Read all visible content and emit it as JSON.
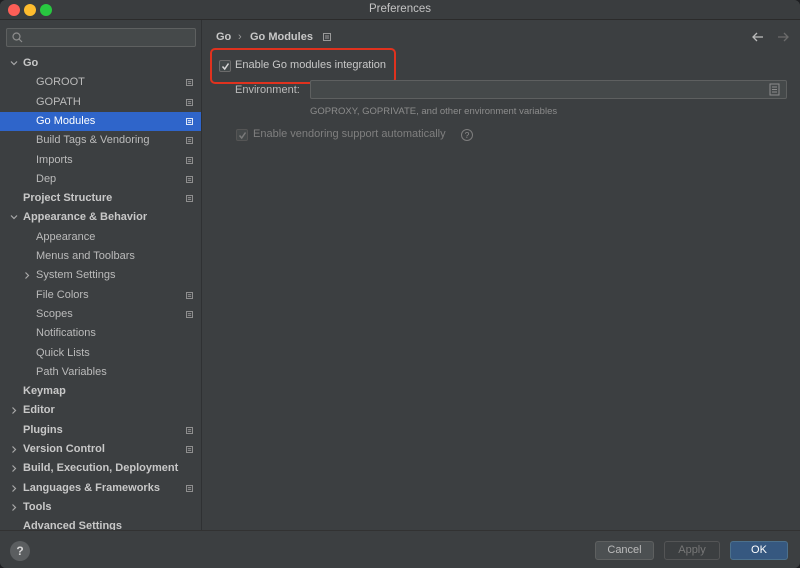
{
  "window": {
    "title": "Preferences"
  },
  "search": {
    "placeholder": ""
  },
  "sidebar": {
    "items": [
      {
        "label": "Go",
        "level": 0,
        "bold": true,
        "expander": "expanded",
        "project_icon": false,
        "selected": false
      },
      {
        "label": "GOROOT",
        "level": 1,
        "bold": false,
        "expander": "none",
        "project_icon": true,
        "selected": false
      },
      {
        "label": "GOPATH",
        "level": 1,
        "bold": false,
        "expander": "none",
        "project_icon": true,
        "selected": false
      },
      {
        "label": "Go Modules",
        "level": 1,
        "bold": false,
        "expander": "none",
        "project_icon": true,
        "selected": true
      },
      {
        "label": "Build Tags & Vendoring",
        "level": 1,
        "bold": false,
        "expander": "none",
        "project_icon": true,
        "selected": false
      },
      {
        "label": "Imports",
        "level": 1,
        "bold": false,
        "expander": "none",
        "project_icon": true,
        "selected": false
      },
      {
        "label": "Dep",
        "level": 1,
        "bold": false,
        "expander": "none",
        "project_icon": true,
        "selected": false
      },
      {
        "label": "Project Structure",
        "level": 0,
        "bold": true,
        "expander": "none",
        "project_icon": true,
        "selected": false
      },
      {
        "label": "Appearance & Behavior",
        "level": 0,
        "bold": true,
        "expander": "expanded",
        "project_icon": false,
        "selected": false
      },
      {
        "label": "Appearance",
        "level": 1,
        "bold": false,
        "expander": "none",
        "project_icon": false,
        "selected": false
      },
      {
        "label": "Menus and Toolbars",
        "level": 1,
        "bold": false,
        "expander": "none",
        "project_icon": false,
        "selected": false
      },
      {
        "label": "System Settings",
        "level": 1,
        "bold": false,
        "expander": "collapsed",
        "project_icon": false,
        "selected": false
      },
      {
        "label": "File Colors",
        "level": 1,
        "bold": false,
        "expander": "none",
        "project_icon": true,
        "selected": false
      },
      {
        "label": "Scopes",
        "level": 1,
        "bold": false,
        "expander": "none",
        "project_icon": true,
        "selected": false
      },
      {
        "label": "Notifications",
        "level": 1,
        "bold": false,
        "expander": "none",
        "project_icon": false,
        "selected": false
      },
      {
        "label": "Quick Lists",
        "level": 1,
        "bold": false,
        "expander": "none",
        "project_icon": false,
        "selected": false
      },
      {
        "label": "Path Variables",
        "level": 1,
        "bold": false,
        "expander": "none",
        "project_icon": false,
        "selected": false
      },
      {
        "label": "Keymap",
        "level": 0,
        "bold": true,
        "expander": "none",
        "project_icon": false,
        "selected": false
      },
      {
        "label": "Editor",
        "level": 0,
        "bold": true,
        "expander": "collapsed",
        "project_icon": false,
        "selected": false
      },
      {
        "label": "Plugins",
        "level": 0,
        "bold": true,
        "expander": "none",
        "project_icon": true,
        "selected": false
      },
      {
        "label": "Version Control",
        "level": 0,
        "bold": true,
        "expander": "collapsed",
        "project_icon": true,
        "selected": false
      },
      {
        "label": "Build, Execution, Deployment",
        "level": 0,
        "bold": true,
        "expander": "collapsed",
        "project_icon": false,
        "selected": false
      },
      {
        "label": "Languages & Frameworks",
        "level": 0,
        "bold": true,
        "expander": "collapsed",
        "project_icon": true,
        "selected": false
      },
      {
        "label": "Tools",
        "level": 0,
        "bold": true,
        "expander": "collapsed",
        "project_icon": false,
        "selected": false
      },
      {
        "label": "Advanced Settings",
        "level": 0,
        "bold": true,
        "expander": "none",
        "project_icon": false,
        "selected": false
      }
    ]
  },
  "breadcrumb": {
    "parent": "Go",
    "current": "Go Modules",
    "separator": "›"
  },
  "settings": {
    "enable_modules_label": "Enable Go modules integration",
    "enable_modules_checked": true,
    "environment_label": "Environment:",
    "environment_value": "",
    "environment_hint": "GOPROXY, GOPRIVATE, and other environment variables",
    "vendoring_label": "Enable vendoring support automatically",
    "vendoring_checked": true,
    "vendoring_enabled": false
  },
  "buttons": {
    "help": "?",
    "cancel": "Cancel",
    "apply": "Apply",
    "ok": "OK"
  },
  "colors": {
    "selection": "#2f65ca",
    "highlight_border": "#e0321e",
    "ok_button": "#365880"
  },
  "icons": [
    "search-icon",
    "chevron-down-icon",
    "chevron-right-icon",
    "project-level-icon",
    "back-arrow-icon",
    "forward-arrow-icon",
    "document-icon",
    "help-icon",
    "check-icon"
  ]
}
